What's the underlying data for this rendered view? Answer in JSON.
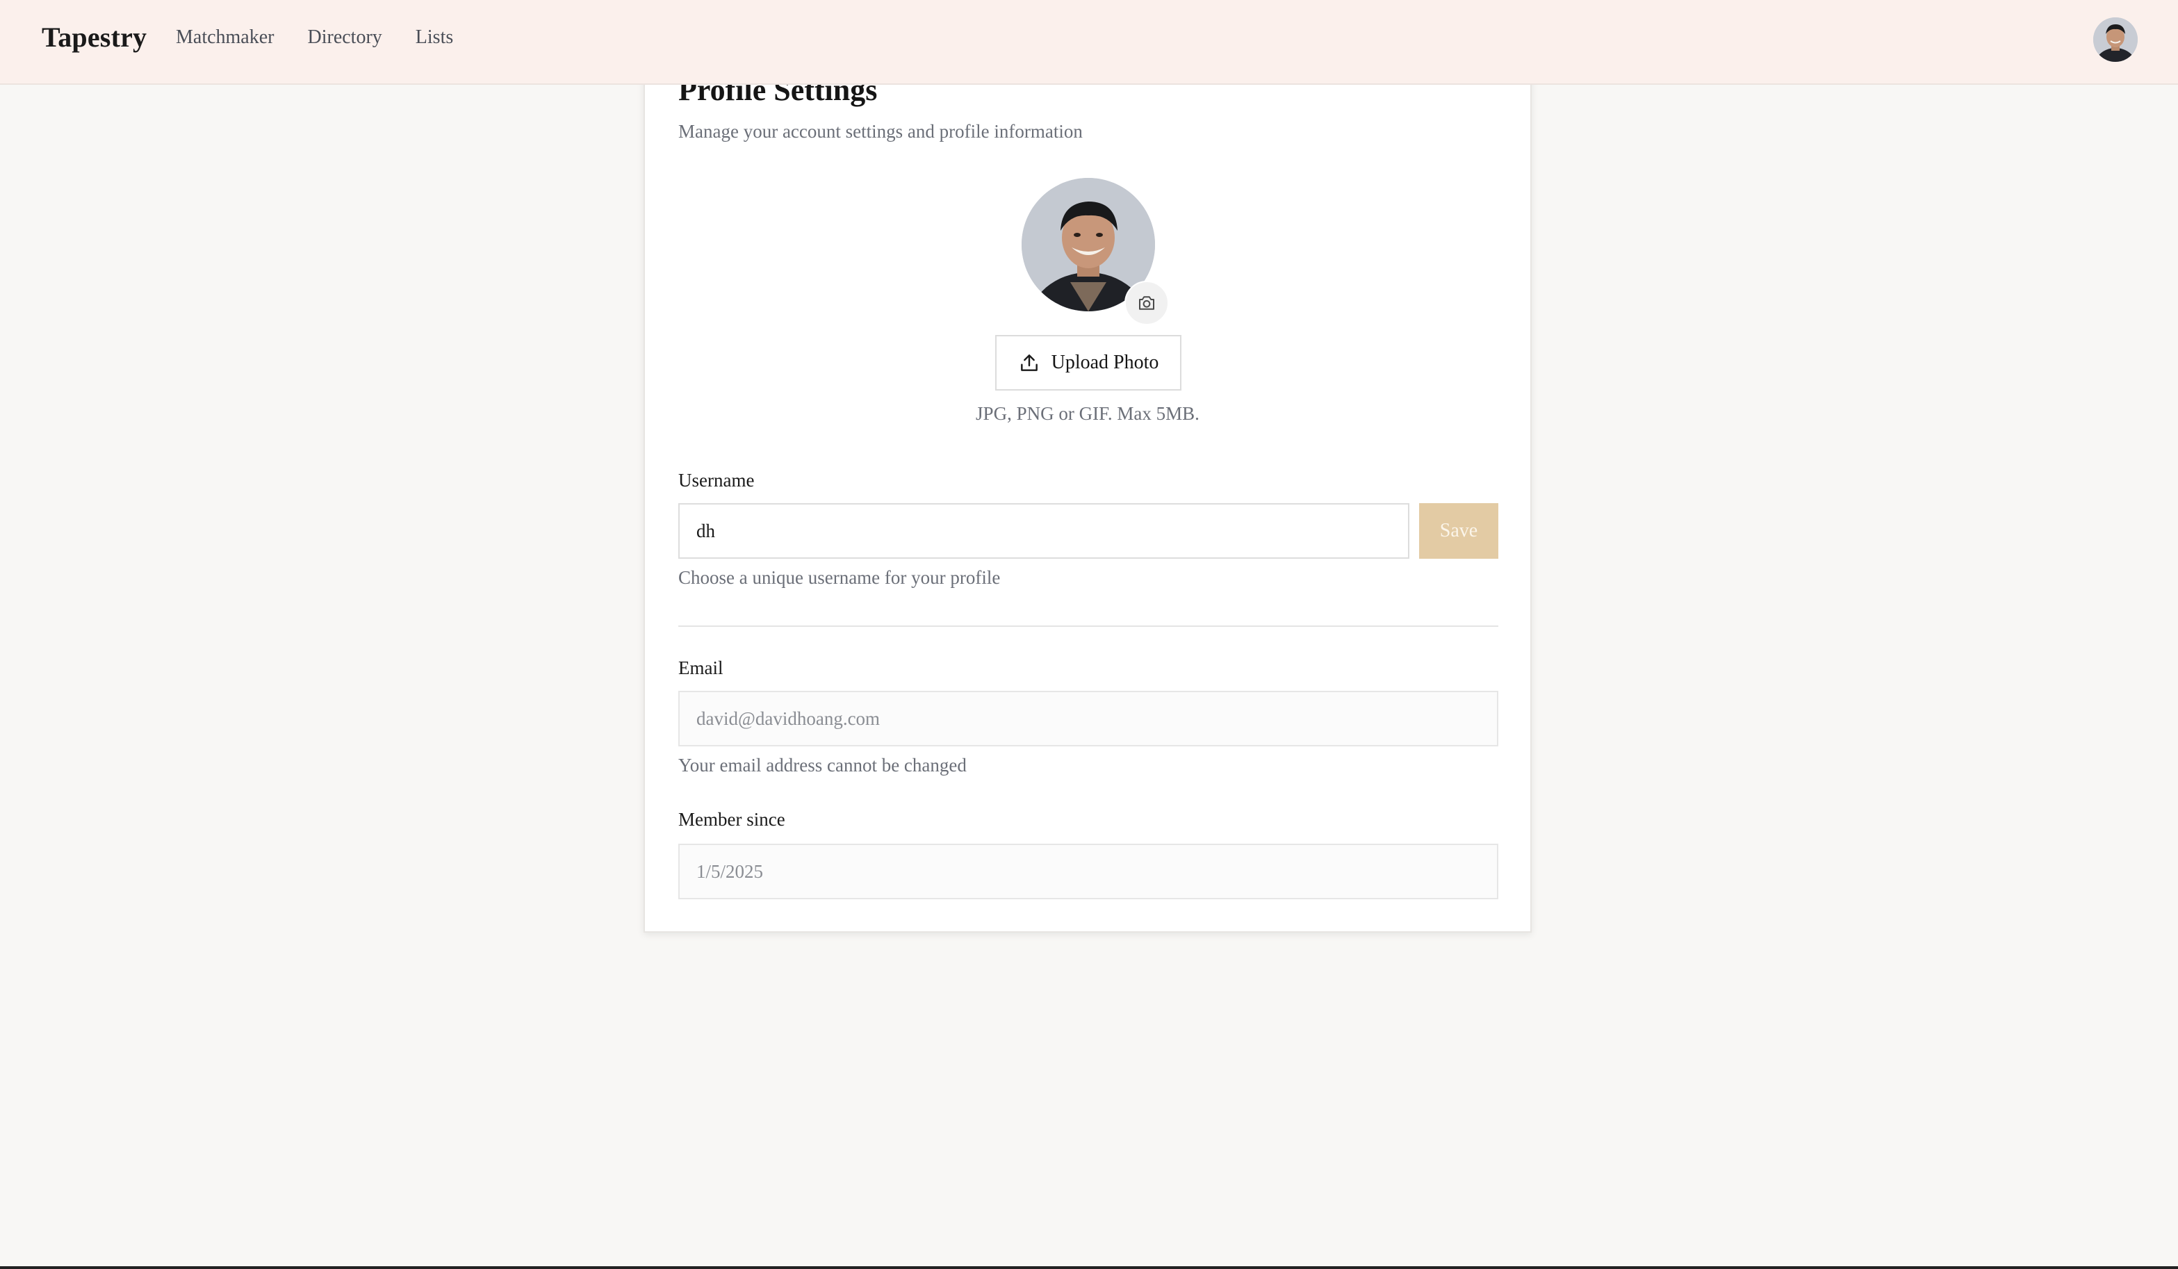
{
  "header": {
    "brand": "Tapestry",
    "nav": [
      "Matchmaker",
      "Directory",
      "Lists"
    ]
  },
  "profile": {
    "title": "Profile Settings",
    "subtitle": "Manage your account settings and profile information",
    "upload_label": "Upload Photo",
    "upload_hint": "JPG, PNG or GIF. Max 5MB.",
    "username": {
      "label": "Username",
      "value": "dh",
      "save_label": "Save",
      "help": "Choose a unique username for your profile"
    },
    "email": {
      "label": "Email",
      "value": "david@davidhoang.com",
      "help": "Your email address cannot be changed"
    },
    "member_since": {
      "label": "Member since",
      "value": "1/5/2025"
    }
  },
  "icons": {
    "camera": "camera-icon",
    "upload": "upload-icon",
    "avatar": "user-avatar"
  },
  "colors": {
    "header_bg": "#fbf0ec",
    "page_bg": "#f8f7f5",
    "save_button": "#e3cba4"
  }
}
